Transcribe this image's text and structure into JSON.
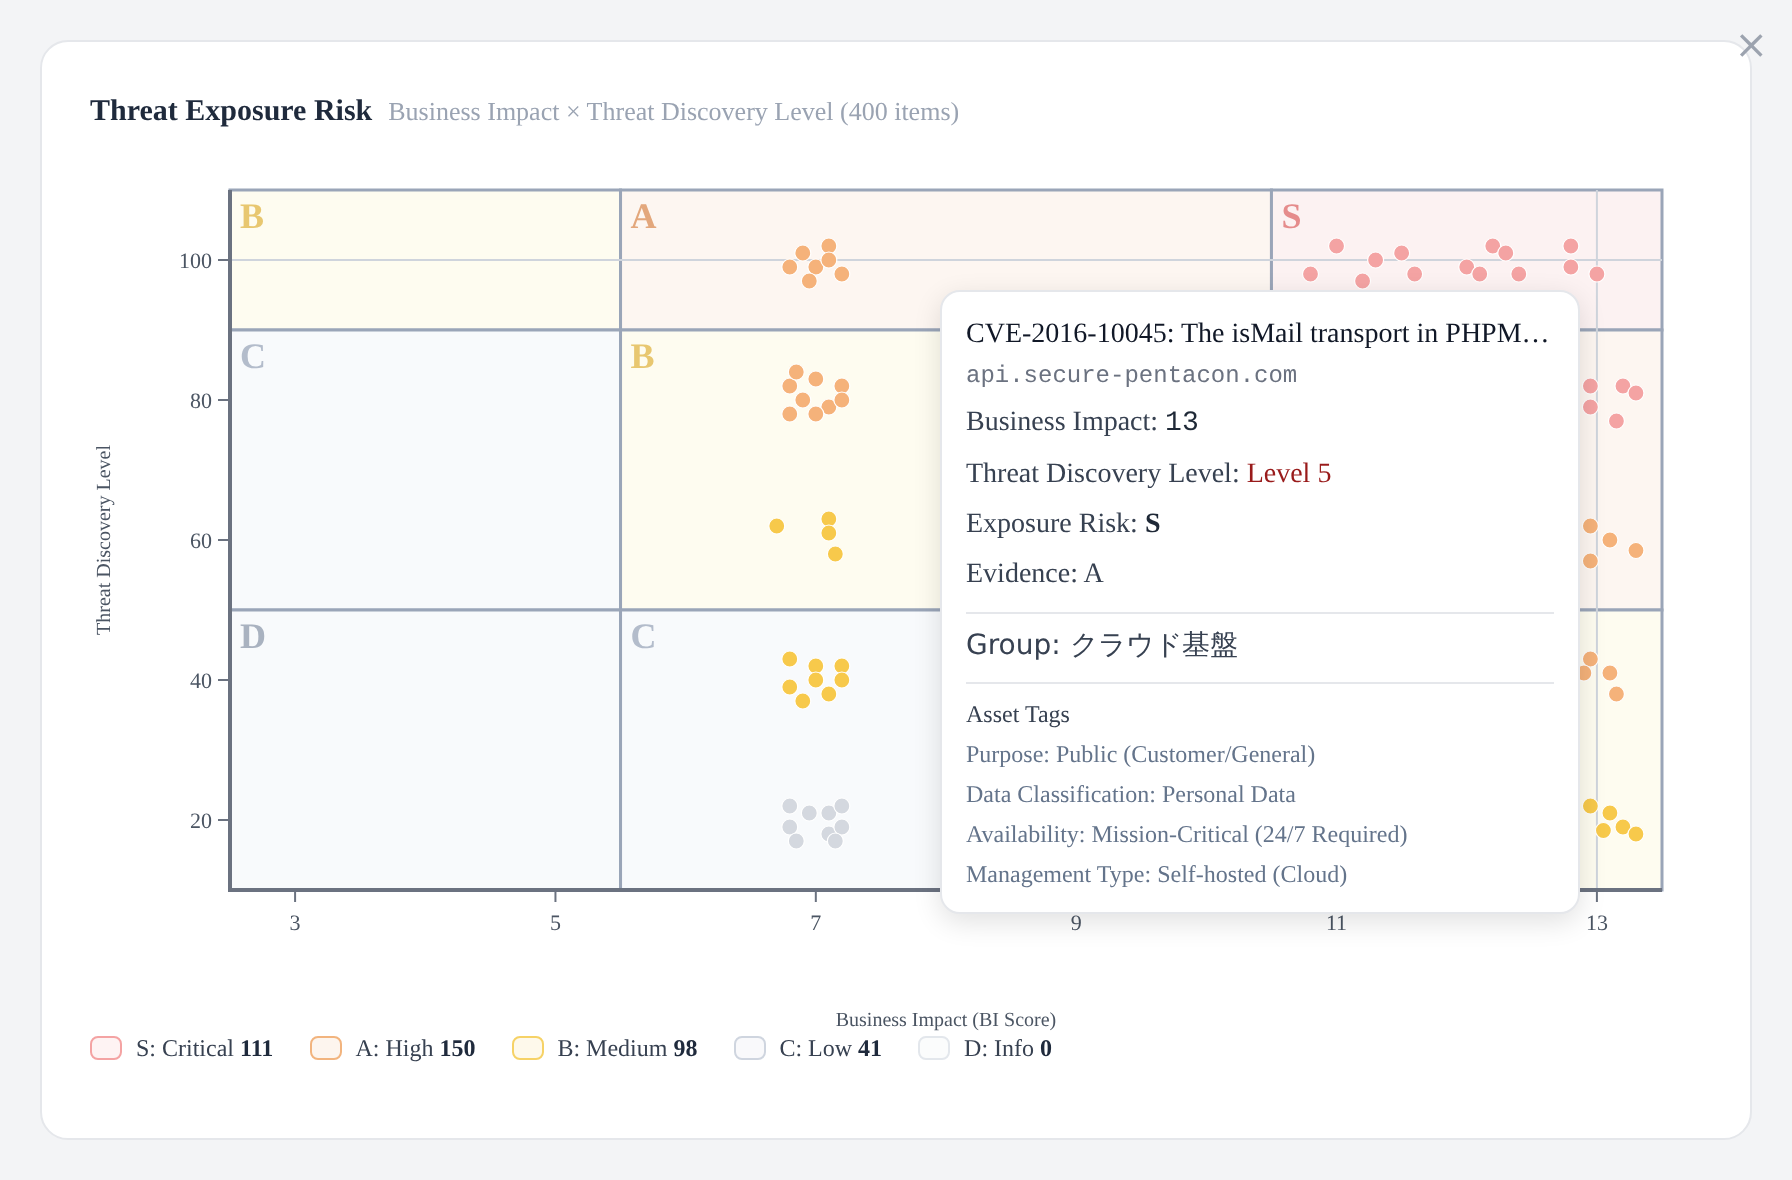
{
  "header": {
    "title": "Threat Exposure Risk",
    "subtitle": "Business Impact × Threat Discovery Level (400 items)"
  },
  "close_button": {
    "label": "×"
  },
  "zone_rows": [
    [
      {
        "label": "B",
        "kind": "medium"
      },
      {
        "label": "A",
        "kind": "high"
      },
      {
        "label": "S",
        "kind": "critical"
      }
    ],
    [
      {
        "label": "C",
        "kind": "low"
      },
      {
        "label": "B",
        "kind": "medium"
      },
      {
        "kind": "high"
      }
    ],
    [
      {
        "label": "D",
        "kind": "info"
      },
      {
        "label": "C",
        "kind": "low"
      },
      {
        "kind": "medium"
      }
    ]
  ],
  "chart_data": {
    "type": "scatter",
    "xlabel": "Business Impact (BI Score)",
    "ylabel": "Threat Discovery Level",
    "xlim": [
      2.5,
      13.5
    ],
    "ylim": [
      10,
      110
    ],
    "xticks": [
      3,
      5,
      7,
      9,
      11,
      13
    ],
    "yticks": [
      20,
      40,
      60,
      80,
      100
    ],
    "series": [
      {
        "color": "#f4a3a3",
        "x": [
          11.0,
          11.3,
          10.8,
          11.5,
          11.2,
          11.6,
          12.2,
          12.0,
          12.4,
          12.3,
          12.8,
          12.8,
          12.1,
          13.0,
          12.95,
          13.2,
          13.3,
          13.15,
          12.95
        ],
        "values": [
          102,
          100,
          98,
          101,
          97,
          98,
          102,
          99,
          98,
          101,
          102,
          99,
          98,
          98,
          82,
          82,
          81,
          77,
          79
        ]
      },
      {
        "color": "#f5b27a",
        "x": [
          6.9,
          7.1,
          7.0,
          6.8,
          7.2,
          7.1,
          6.95,
          6.8,
          7.0,
          7.2,
          6.9,
          7.1,
          6.8,
          7.2,
          7.0,
          6.85,
          12.95,
          13.1,
          13.3,
          12.95,
          12.95,
          13.1,
          13.15,
          12.9
        ],
        "values": [
          101,
          102,
          99,
          99,
          98,
          100,
          97,
          82,
          83,
          82,
          80,
          79,
          78,
          80,
          78,
          84,
          62,
          60,
          58.5,
          57,
          43,
          41,
          38,
          41
        ]
      },
      {
        "color": "#f7c94b",
        "x": [
          6.7,
          7.1,
          7.1,
          7.15,
          6.8,
          7.0,
          7.2,
          6.8,
          6.9,
          7.1,
          7.2,
          7.0,
          12.95,
          13.1,
          13.2,
          13.3,
          13.05
        ],
        "values": [
          62,
          63,
          61,
          58,
          43,
          42,
          42,
          39,
          37,
          38,
          40,
          40,
          22,
          21,
          19,
          18,
          18.5
        ]
      },
      {
        "color": "#d4d8df",
        "x": [
          6.8,
          6.95,
          7.1,
          7.2,
          6.8,
          6.85,
          7.1,
          7.2,
          7.15
        ],
        "values": [
          22,
          21,
          21,
          22,
          19,
          17,
          18,
          19,
          17
        ]
      }
    ]
  },
  "tooltip": {
    "title": "CVE-2016-10045: The isMail transport in PHPM…",
    "host": "api.secure-pentacon.com",
    "fields": [
      {
        "label": "Business Impact: ",
        "value": "13",
        "kind": "mono"
      },
      {
        "label": "Threat Discovery Level: ",
        "value": "Level 5",
        "kind": "danger"
      },
      {
        "label": "Exposure Risk: ",
        "value": "S",
        "kind": "bold"
      },
      {
        "label": "Evidence: ",
        "value": "A",
        "kind": "plain"
      }
    ],
    "group": "Group: クラウド基盤",
    "tags_title": "Asset Tags",
    "tags": [
      "Purpose: Public (Customer/General)",
      "Data Classification: Personal Data",
      "Availability: Mission-Critical (24/7 Required)",
      "Management Type: Self-hosted (Cloud)"
    ]
  },
  "legend": [
    {
      "label": "S: Critical ",
      "count": "111",
      "color": "#f4a3a3"
    },
    {
      "label": "A: High ",
      "count": "150",
      "color": "#f2b47e"
    },
    {
      "label": "B: Medium ",
      "count": "98",
      "color": "#f6d266"
    },
    {
      "label": "C: Low ",
      "count": "41",
      "color": "#cfd5df"
    },
    {
      "label": "D: Info ",
      "count": "0",
      "color": "#e3e7ec"
    }
  ]
}
